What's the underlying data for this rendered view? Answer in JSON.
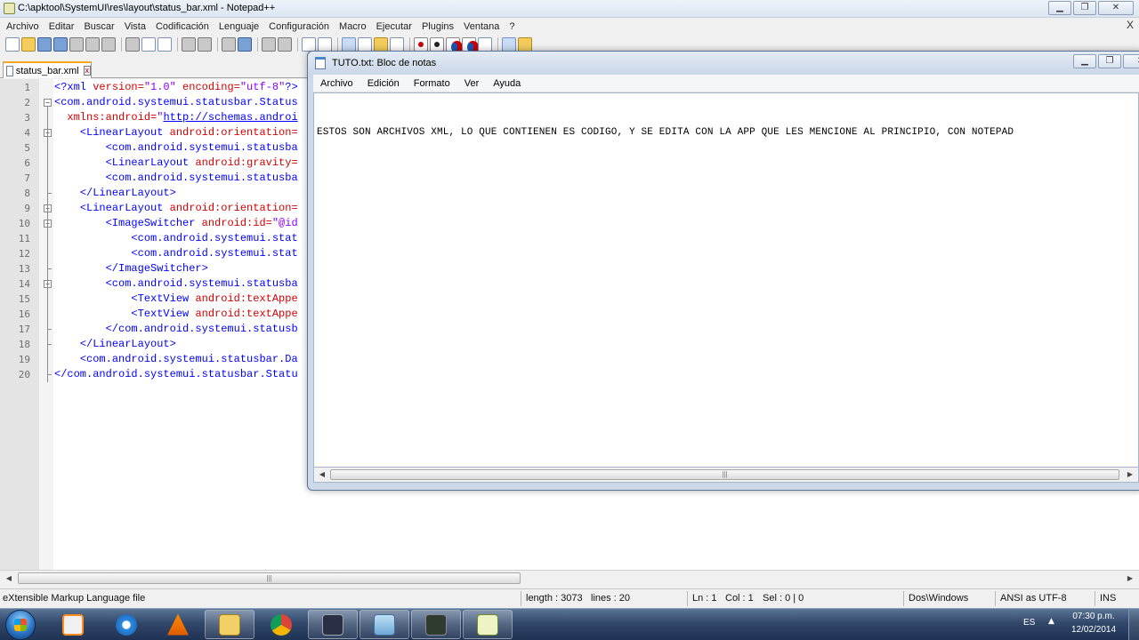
{
  "npp": {
    "title": "C:\\apktool\\SystemUI\\res\\layout\\status_bar.xml - Notepad++",
    "menu": [
      "Archivo",
      "Editar",
      "Buscar",
      "Vista",
      "Codificación",
      "Lenguaje",
      "Configuración",
      "Macro",
      "Ejecutar",
      "Plugins",
      "Ventana",
      "?"
    ],
    "menu_close": "X",
    "tab_label": "status_bar.xml",
    "tab_close": "x",
    "line_numbers": [
      "1",
      "2",
      "3",
      "4",
      "5",
      "6",
      "7",
      "8",
      "9",
      "10",
      "11",
      "12",
      "13",
      "14",
      "15",
      "16",
      "17",
      "18",
      "19",
      "20"
    ],
    "code": [
      {
        "indent": "",
        "tag": "<?xml ",
        "attr": "version=",
        "val": "\"1.0\" ",
        "attr2": "encoding=",
        "val2": "\"utf-8\"",
        "tail": "?>"
      },
      {
        "indent": "",
        "tag": "<com.android.systemui.statusbar.Status",
        "attr": "",
        "val": "",
        "attr2": "",
        "val2": "",
        "tail": ""
      },
      {
        "indent": "  ",
        "tag": "",
        "attr": "xmlns:android=",
        "val": "\"",
        "link": "http://schemas.androi",
        "tail": ""
      },
      {
        "indent": "    ",
        "tag": "<LinearLayout ",
        "attr": "android:orientation=",
        "val": "",
        "tail": ""
      },
      {
        "indent": "        ",
        "tag": "<com.android.systemui.statusba",
        "attr": "",
        "val": "",
        "tail": ""
      },
      {
        "indent": "        ",
        "tag": "<LinearLayout ",
        "attr": "android:gravity=",
        "val": "",
        "tail": ""
      },
      {
        "indent": "        ",
        "tag": "<com.android.systemui.statusba",
        "attr": "",
        "val": "",
        "tail": ""
      },
      {
        "indent": "    ",
        "tag": "</LinearLayout>",
        "attr": "",
        "val": "",
        "tail": ""
      },
      {
        "indent": "    ",
        "tag": "<LinearLayout ",
        "attr": "android:orientation=",
        "val": "",
        "tail": ""
      },
      {
        "indent": "        ",
        "tag": "<ImageSwitcher ",
        "attr": "android:id=",
        "val": "\"@id",
        "tail": ""
      },
      {
        "indent": "            ",
        "tag": "<com.android.systemui.stat",
        "attr": "",
        "val": "",
        "tail": ""
      },
      {
        "indent": "            ",
        "tag": "<com.android.systemui.stat",
        "attr": "",
        "val": "",
        "tail": ""
      },
      {
        "indent": "        ",
        "tag": "</ImageSwitcher>",
        "attr": "",
        "val": "",
        "tail": ""
      },
      {
        "indent": "        ",
        "tag": "<com.android.systemui.statusba",
        "attr": "",
        "val": "",
        "tail": ""
      },
      {
        "indent": "            ",
        "tag": "<TextView ",
        "attr": "android:textAppe",
        "val": "",
        "tail": ""
      },
      {
        "indent": "            ",
        "tag": "<TextView ",
        "attr": "android:textAppe",
        "val": "",
        "tail": ""
      },
      {
        "indent": "        ",
        "tag": "</com.android.systemui.statusb",
        "attr": "",
        "val": "",
        "tail": ""
      },
      {
        "indent": "    ",
        "tag": "</LinearLayout>",
        "attr": "",
        "val": "",
        "tail": ""
      },
      {
        "indent": "    ",
        "tag": "<com.android.systemui.statusbar.Da",
        "attr": "",
        "val": "",
        "tail": ""
      },
      {
        "indent": "",
        "tag": "</com.android.systemui.statusbar.Statu",
        "attr": "",
        "val": "",
        "tail": ""
      }
    ],
    "status": {
      "file_type": "eXtensible Markup Language file",
      "length": "length : 3073",
      "lines": "lines : 20",
      "ln": "Ln : 1",
      "col": "Col : 1",
      "sel": "Sel : 0 | 0",
      "eol": "Dos\\Windows",
      "encoding": "ANSI as UTF-8",
      "mode": "INS"
    }
  },
  "notepad": {
    "title": "TUTO.txt: Bloc de notas",
    "menu": [
      "Archivo",
      "Edición",
      "Formato",
      "Ver",
      "Ayuda"
    ],
    "text": "ESTOS SON ARCHIVOS XML, LO QUE CONTIENEN ES CODIGO, Y SE EDITA CON LA APP QUE LES MENCIONE AL PRINCIPIO, CON NOTEPAD"
  },
  "taskbar": {
    "apps": [
      "media-center-icon",
      "internet-explorer-icon",
      "vlc-icon",
      "file-explorer-icon",
      "chrome-icon",
      "terminal-icon",
      "notepad-icon",
      "app-icon",
      "notepad-plus-plus-icon"
    ],
    "lang": "ES",
    "time": "07:30 p.m.",
    "date": "12/02/2014"
  },
  "colors": {
    "xml_tag": "#0000ff",
    "xml_attr": "#d50000",
    "xml_value": "#8b00ff",
    "tab_accent": "#f5a623"
  }
}
